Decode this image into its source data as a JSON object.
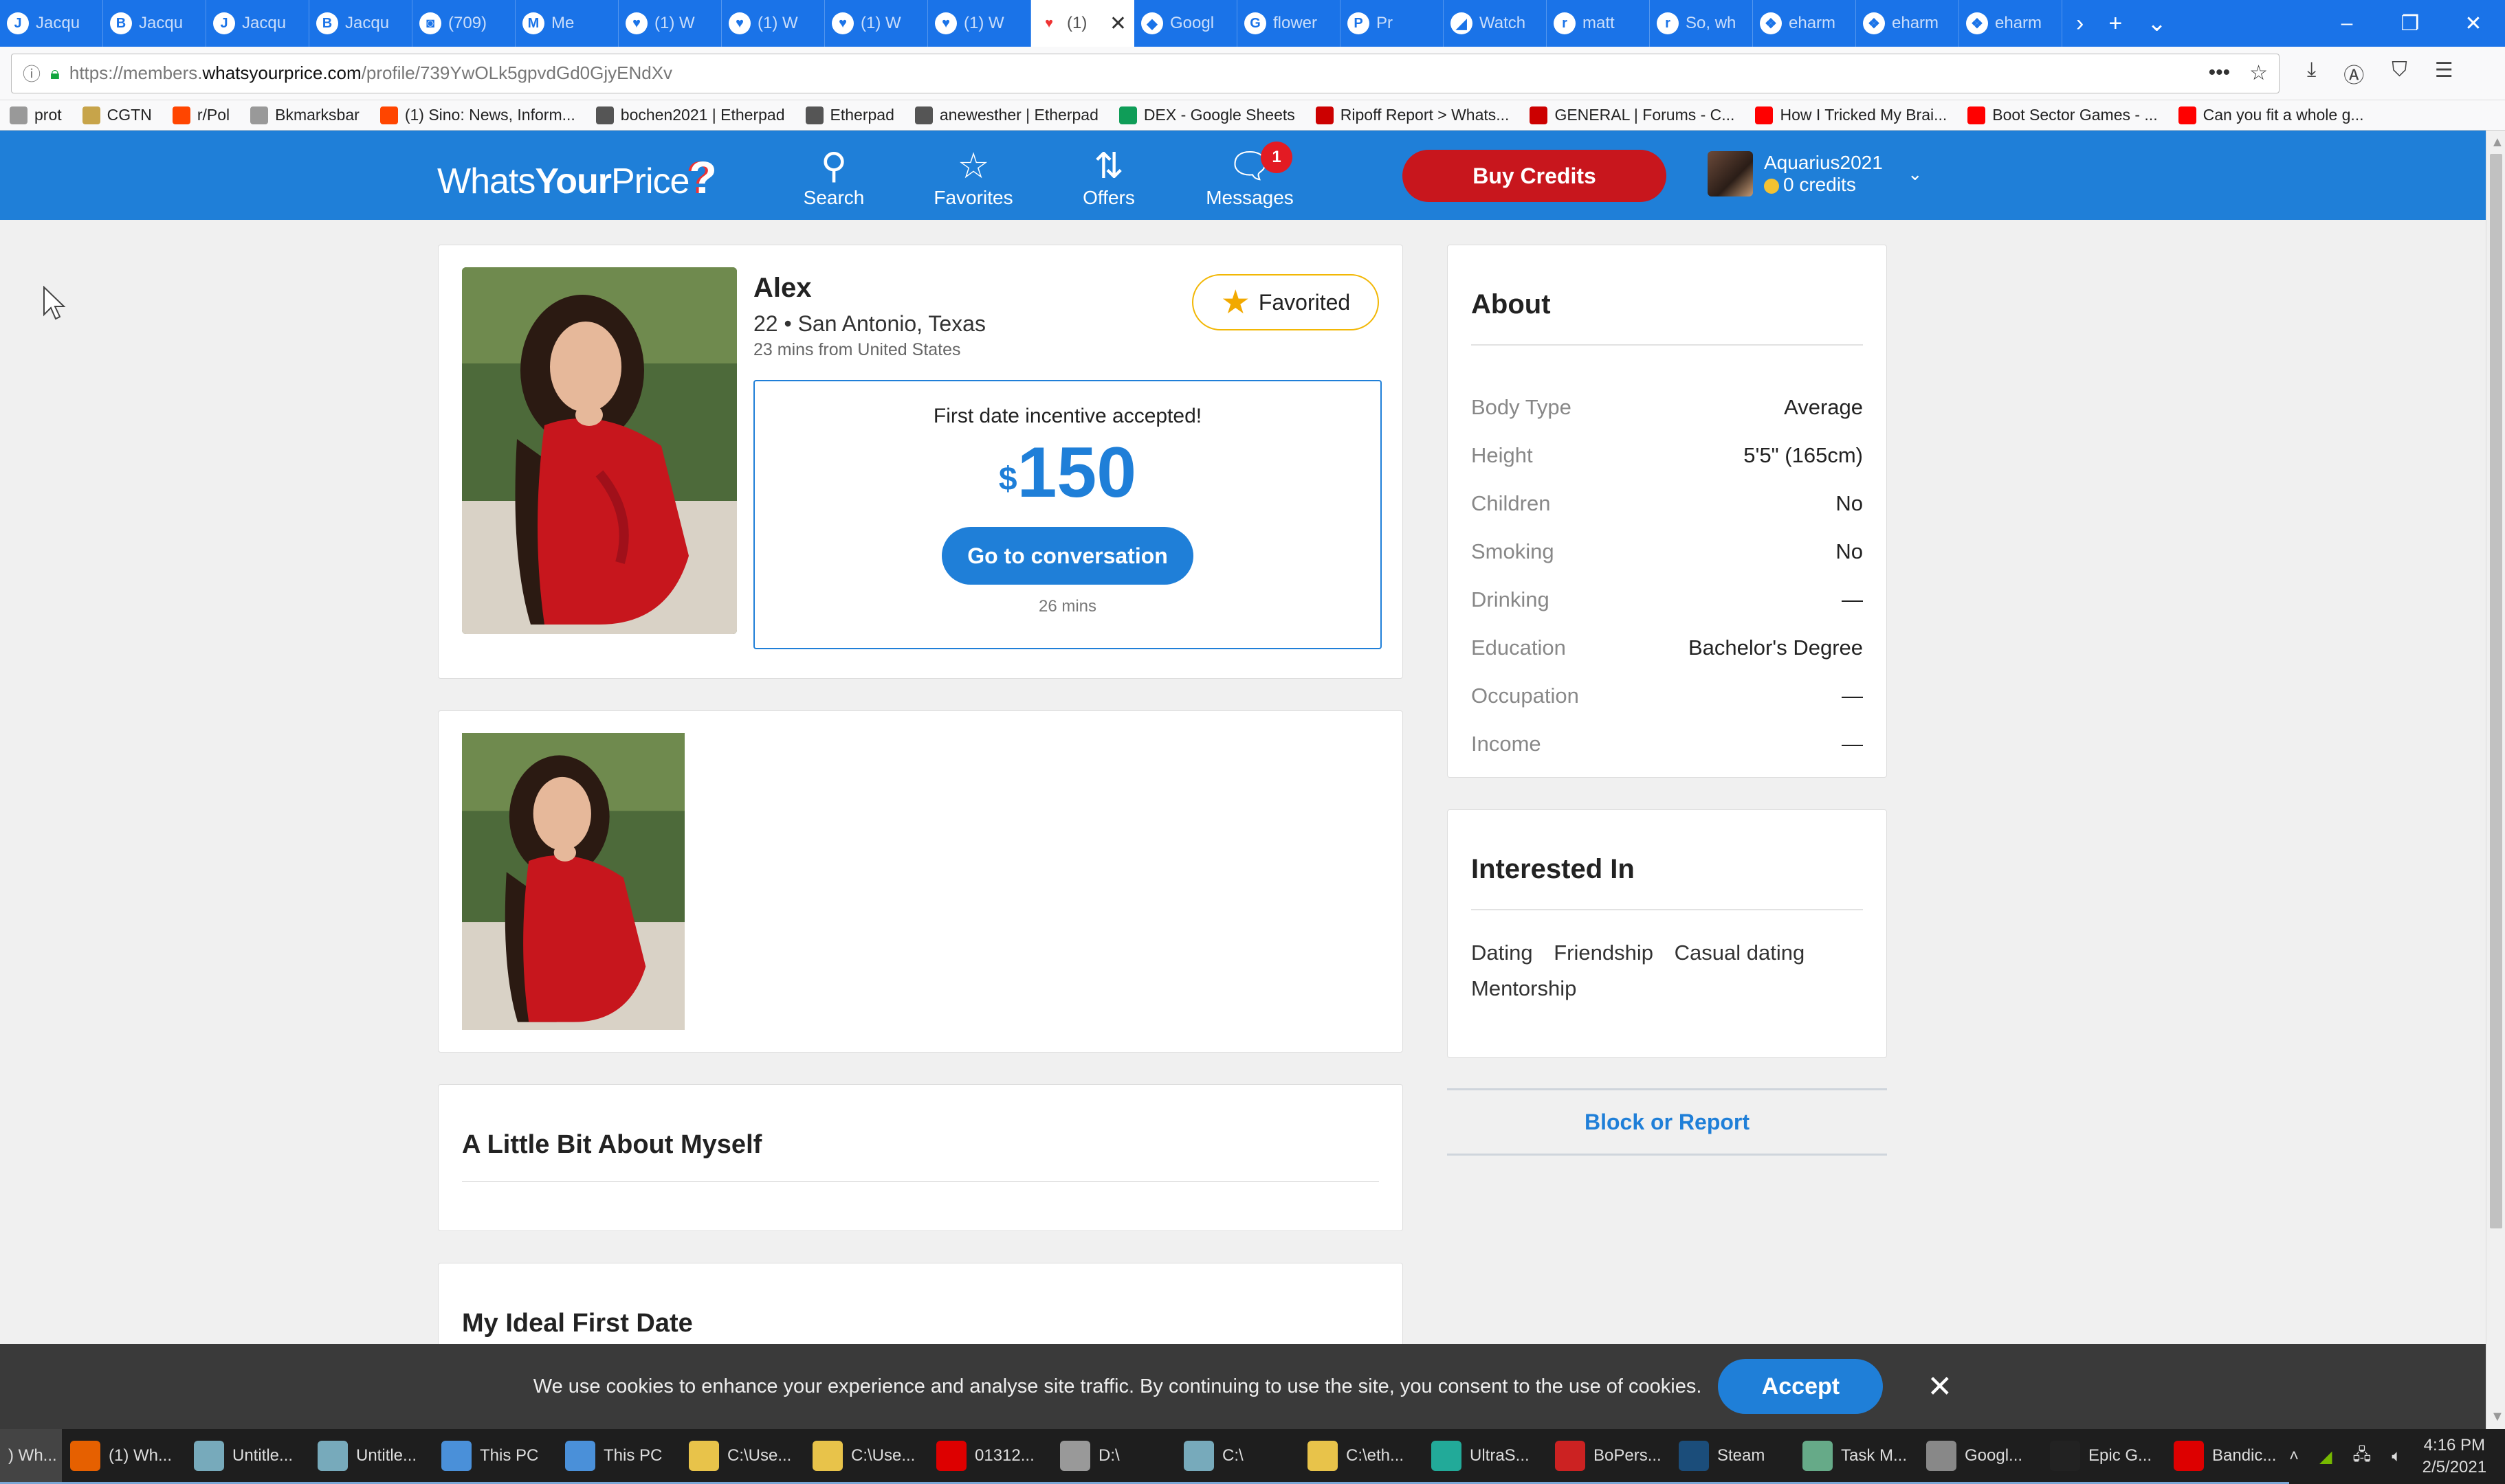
{
  "browser": {
    "tabs": [
      {
        "title": "Jacqu",
        "icon": "J"
      },
      {
        "title": "Jacqu",
        "icon": "B"
      },
      {
        "title": "Jacqu",
        "icon": "J"
      },
      {
        "title": "Jacqu",
        "icon": "B"
      },
      {
        "title": "(709)",
        "icon": "◙"
      },
      {
        "title": "Me",
        "icon": "M"
      },
      {
        "title": "(1) W",
        "icon": "♥"
      },
      {
        "title": "(1) W",
        "icon": "♥"
      },
      {
        "title": "(1) W",
        "icon": "♥"
      },
      {
        "title": "(1) W",
        "icon": "♥"
      },
      {
        "title": "(1)",
        "icon": "♥",
        "active": true
      },
      {
        "title": "Googl",
        "icon": "◆"
      },
      {
        "title": "flower",
        "icon": "G"
      },
      {
        "title": "Pr",
        "icon": "P"
      },
      {
        "title": "Watch",
        "icon": "◢"
      },
      {
        "title": "matt",
        "icon": "r"
      },
      {
        "title": "So, wh",
        "icon": "r"
      },
      {
        "title": "eharm",
        "icon": "❖"
      },
      {
        "title": "eharm",
        "icon": "❖"
      },
      {
        "title": "eharm",
        "icon": "❖"
      }
    ],
    "url_prefix": "https://members.",
    "url_host": "whatsyourprice.com",
    "url_path": "/profile/739YwOLk5gpvdGd0GjyENdXv",
    "bookmarks": [
      {
        "label": "prot",
        "color": "#999"
      },
      {
        "label": "CGTN",
        "color": "#c7a44a"
      },
      {
        "label": "r/Pol",
        "color": "#ff4500"
      },
      {
        "label": "Bkmarksbar",
        "color": "#999"
      },
      {
        "label": "(1) Sino: News, Inform...",
        "color": "#ff4500"
      },
      {
        "label": "bochen2021 | Etherpad",
        "color": "#555"
      },
      {
        "label": "Etherpad",
        "color": "#555"
      },
      {
        "label": "anewesther | Etherpad",
        "color": "#555"
      },
      {
        "label": "DEX - Google Sheets",
        "color": "#0f9d58"
      },
      {
        "label": "Ripoff Report > Whats...",
        "color": "#c00"
      },
      {
        "label": "GENERAL | Forums - C...",
        "color": "#c00"
      },
      {
        "label": "How I Tricked My Brai...",
        "color": "#f00"
      },
      {
        "label": "Boot Sector Games - ...",
        "color": "#f00"
      },
      {
        "label": "Can you fit a whole g...",
        "color": "#f00"
      }
    ]
  },
  "site": {
    "logo_a": "Whats",
    "logo_b": "Your",
    "logo_c": "Price",
    "nav": {
      "search": "Search",
      "favorites": "Favorites",
      "offers": "Offers",
      "messages": "Messages",
      "messages_badge": "1"
    },
    "buy_credits": "Buy Credits",
    "account": {
      "username": "Aquarius2021",
      "credits": "0 credits"
    }
  },
  "profile": {
    "name": "Alex",
    "info": "22 • San Antonio, Texas",
    "active": "23 mins from United States",
    "favorited": "Favorited",
    "incentive": {
      "heading": "First date incentive accepted!",
      "currency": "$",
      "amount": "150",
      "button": "Go to conversation",
      "time": "26 mins"
    },
    "about_me_title": "A Little Bit About Myself",
    "ideal_date_title": "My Ideal First Date"
  },
  "about": {
    "title": "About",
    "rows": [
      {
        "k": "Body Type",
        "v": "Average"
      },
      {
        "k": "Height",
        "v": "5'5\" (165cm)"
      },
      {
        "k": "Children",
        "v": "No"
      },
      {
        "k": "Smoking",
        "v": "No"
      },
      {
        "k": "Drinking",
        "v": "—"
      },
      {
        "k": "Education",
        "v": "Bachelor's Degree"
      },
      {
        "k": "Occupation",
        "v": "—"
      },
      {
        "k": "Income",
        "v": "—"
      }
    ]
  },
  "interested": {
    "title": "Interested In",
    "items": [
      "Dating",
      "Friendship",
      "Casual dating",
      "Mentorship"
    ]
  },
  "block_report": "Block or Report",
  "cookie": {
    "text": "We use cookies to enhance your experience and analyse site traffic. By continuing to use the site, you consent to the use of cookies.",
    "accept": "Accept"
  },
  "taskbar": {
    "items": [
      {
        "label": ") Wh...",
        "color": "#555"
      },
      {
        "label": "(1) Wh...",
        "color": "#e66000"
      },
      {
        "label": "Untitle...",
        "color": "#7ab"
      },
      {
        "label": "Untitle...",
        "color": "#7ab"
      },
      {
        "label": "This PC",
        "color": "#4a90d9"
      },
      {
        "label": "This PC",
        "color": "#4a90d9"
      },
      {
        "label": "C:\\Use...",
        "color": "#e8c34a"
      },
      {
        "label": "C:\\Use...",
        "color": "#e8c34a"
      },
      {
        "label": "01312...",
        "color": "#d00"
      },
      {
        "label": "D:\\",
        "color": "#999"
      },
      {
        "label": "C:\\",
        "color": "#7ab"
      },
      {
        "label": "C:\\eth...",
        "color": "#e8c34a"
      },
      {
        "label": "UltraS...",
        "color": "#2a9"
      },
      {
        "label": "BoPers...",
        "color": "#c22"
      },
      {
        "label": "Steam",
        "color": "#1b4d7a"
      },
      {
        "label": "Task M...",
        "color": "#6a8"
      },
      {
        "label": "Googl...",
        "color": "#888"
      },
      {
        "label": "Epic G...",
        "color": "#222"
      },
      {
        "label": "Bandic...",
        "color": "#d00"
      }
    ],
    "time": "4:16 PM",
    "date": "2/5/2021"
  }
}
